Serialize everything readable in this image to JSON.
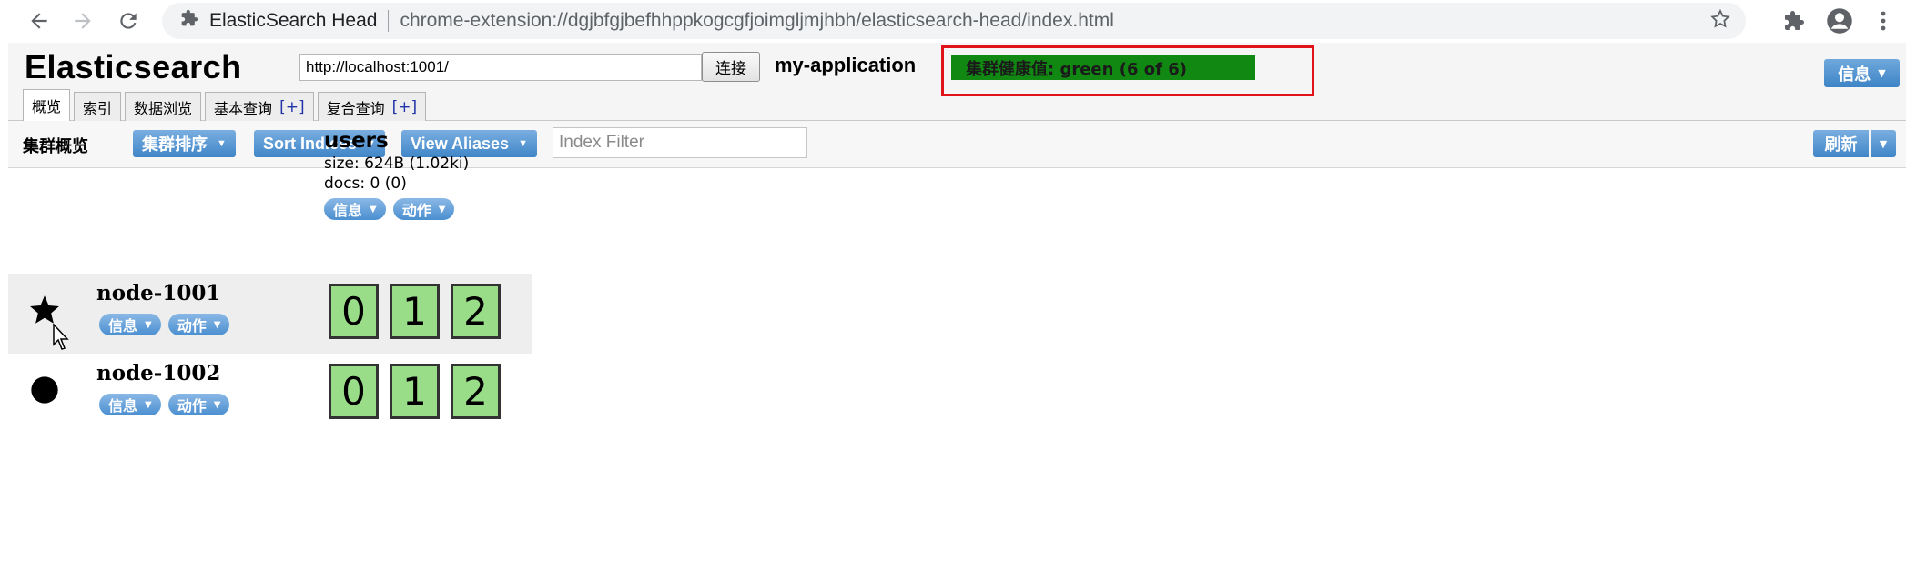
{
  "browser": {
    "back_icon": "arrow-left-icon",
    "forward_icon": "arrow-right-icon",
    "reload_icon": "reload-icon",
    "page_title": "ElasticSearch Head",
    "url": "chrome-extension://dgjbfgjbefhhppkogcgfjoimgljmjhbh/elasticsearch-head/index.html"
  },
  "header": {
    "brand": "Elasticsearch",
    "connect_url": "http://localhost:1001/",
    "connect_label": "连接",
    "cluster_name": "my-application",
    "health_text": "集群健康值: green (6 of 6)",
    "health_color": "#118811",
    "info_label": "信息"
  },
  "tabs": [
    {
      "label": "概览",
      "plus": ""
    },
    {
      "label": "索引",
      "plus": ""
    },
    {
      "label": "数据浏览",
      "plus": ""
    },
    {
      "label": "基本查询",
      "plus": "[+]"
    },
    {
      "label": "复合查询",
      "plus": "[+]"
    }
  ],
  "toolbar": {
    "title": "集群概览",
    "sort_cluster_label": "集群排序",
    "sort_indices_label": "Sort Indices",
    "view_aliases_label": "View Aliases",
    "index_filter_placeholder": "Index Filter",
    "refresh_label": "刷新"
  },
  "index": {
    "name": "users",
    "size": "size: 624B (1.02ki)",
    "docs": "docs: 0 (0)",
    "info_label": "信息",
    "action_label": "动作"
  },
  "nodes": [
    {
      "name": "node-1001",
      "icon": "star-icon",
      "info_label": "信息",
      "action_label": "动作",
      "shards": [
        "0",
        "1",
        "2"
      ]
    },
    {
      "name": "node-1002",
      "icon": "circle-icon",
      "info_label": "信息",
      "action_label": "动作",
      "shards": [
        "0",
        "1",
        "2"
      ]
    }
  ],
  "colors": {
    "shard_fill": "#99dd88",
    "button_blue": "#3f86c8",
    "highlight_frame": "#e0121c"
  }
}
